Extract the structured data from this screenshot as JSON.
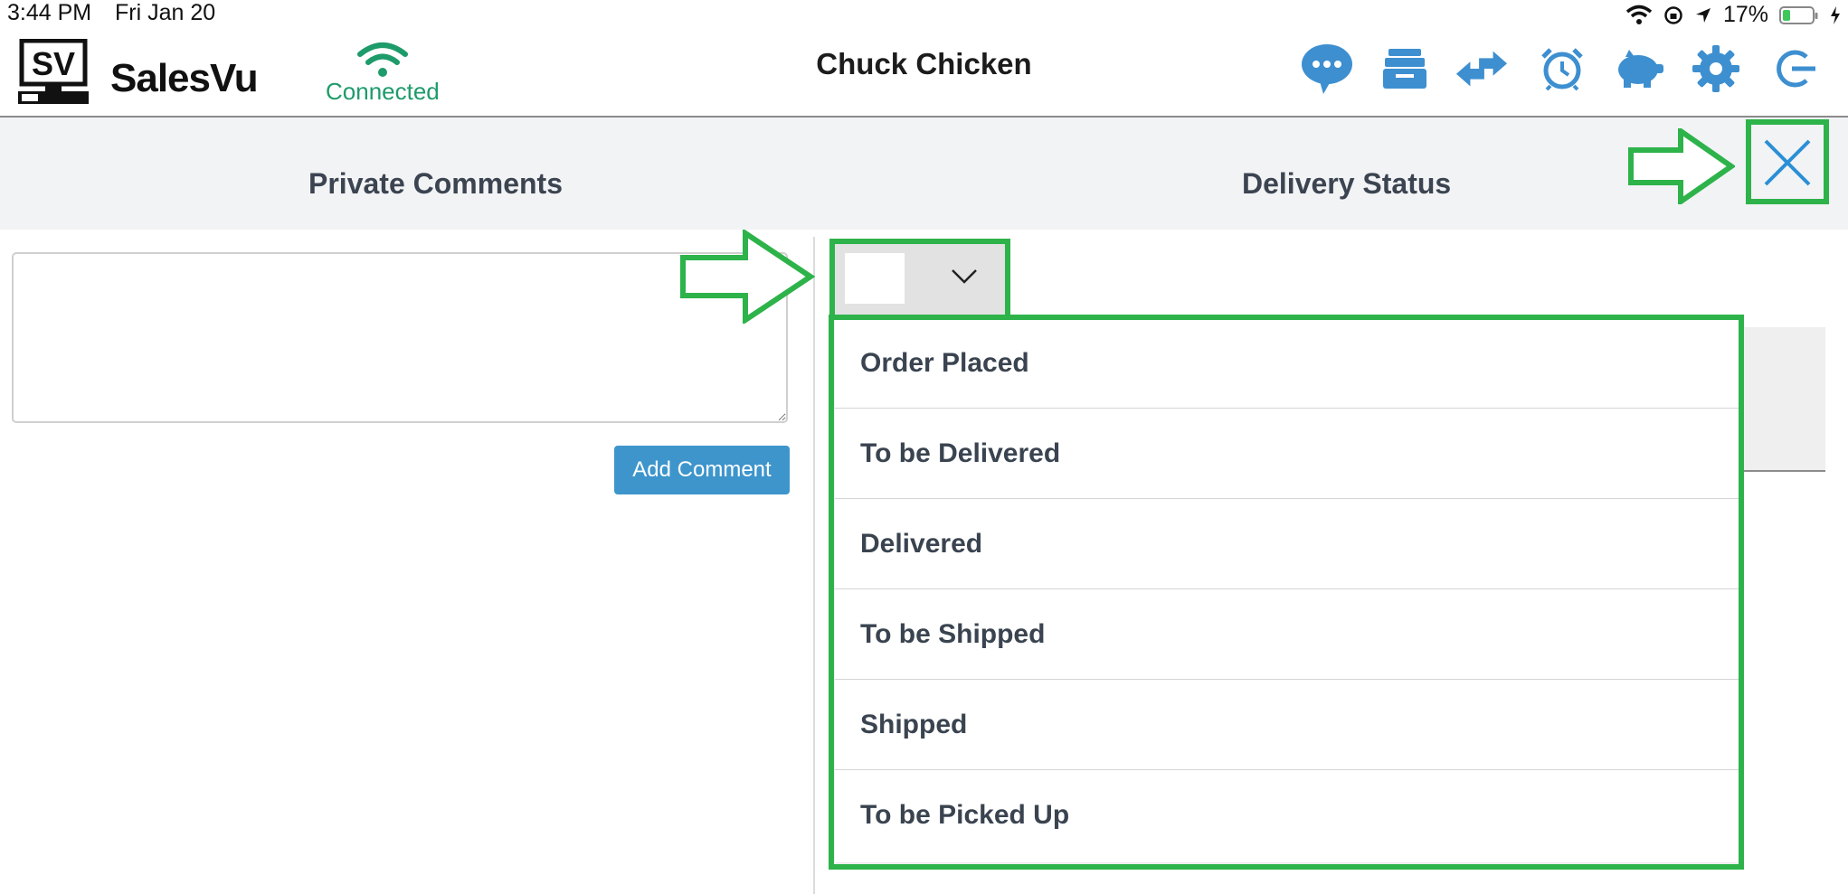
{
  "status_bar": {
    "time": "3:44 PM",
    "date": "Fri Jan 20",
    "battery": "17%"
  },
  "header": {
    "logo_text": "SV",
    "brand": "SalesVu",
    "connection_label": "Connected",
    "store_name": "Chuck Chicken",
    "icons": [
      "chat-icon",
      "register-drawer-icon",
      "transfer-arrows-icon",
      "alarm-clock-icon",
      "piggy-bank-icon",
      "settings-gear-icon",
      "logout-icon"
    ]
  },
  "columns": {
    "left_title": "Private Comments",
    "right_title": "Delivery Status"
  },
  "comment": {
    "value": "",
    "button_label": "Add Comment"
  },
  "delivery_select": {
    "selected": "",
    "options": [
      "Order Placed",
      "To be Delivered",
      "Delivered",
      "To be Shipped",
      "Shipped",
      "To be Picked Up"
    ]
  },
  "colors": {
    "accent_blue": "#3d95cc",
    "connected_green": "#1e9b6a",
    "annotation_green": "#2db34a"
  }
}
